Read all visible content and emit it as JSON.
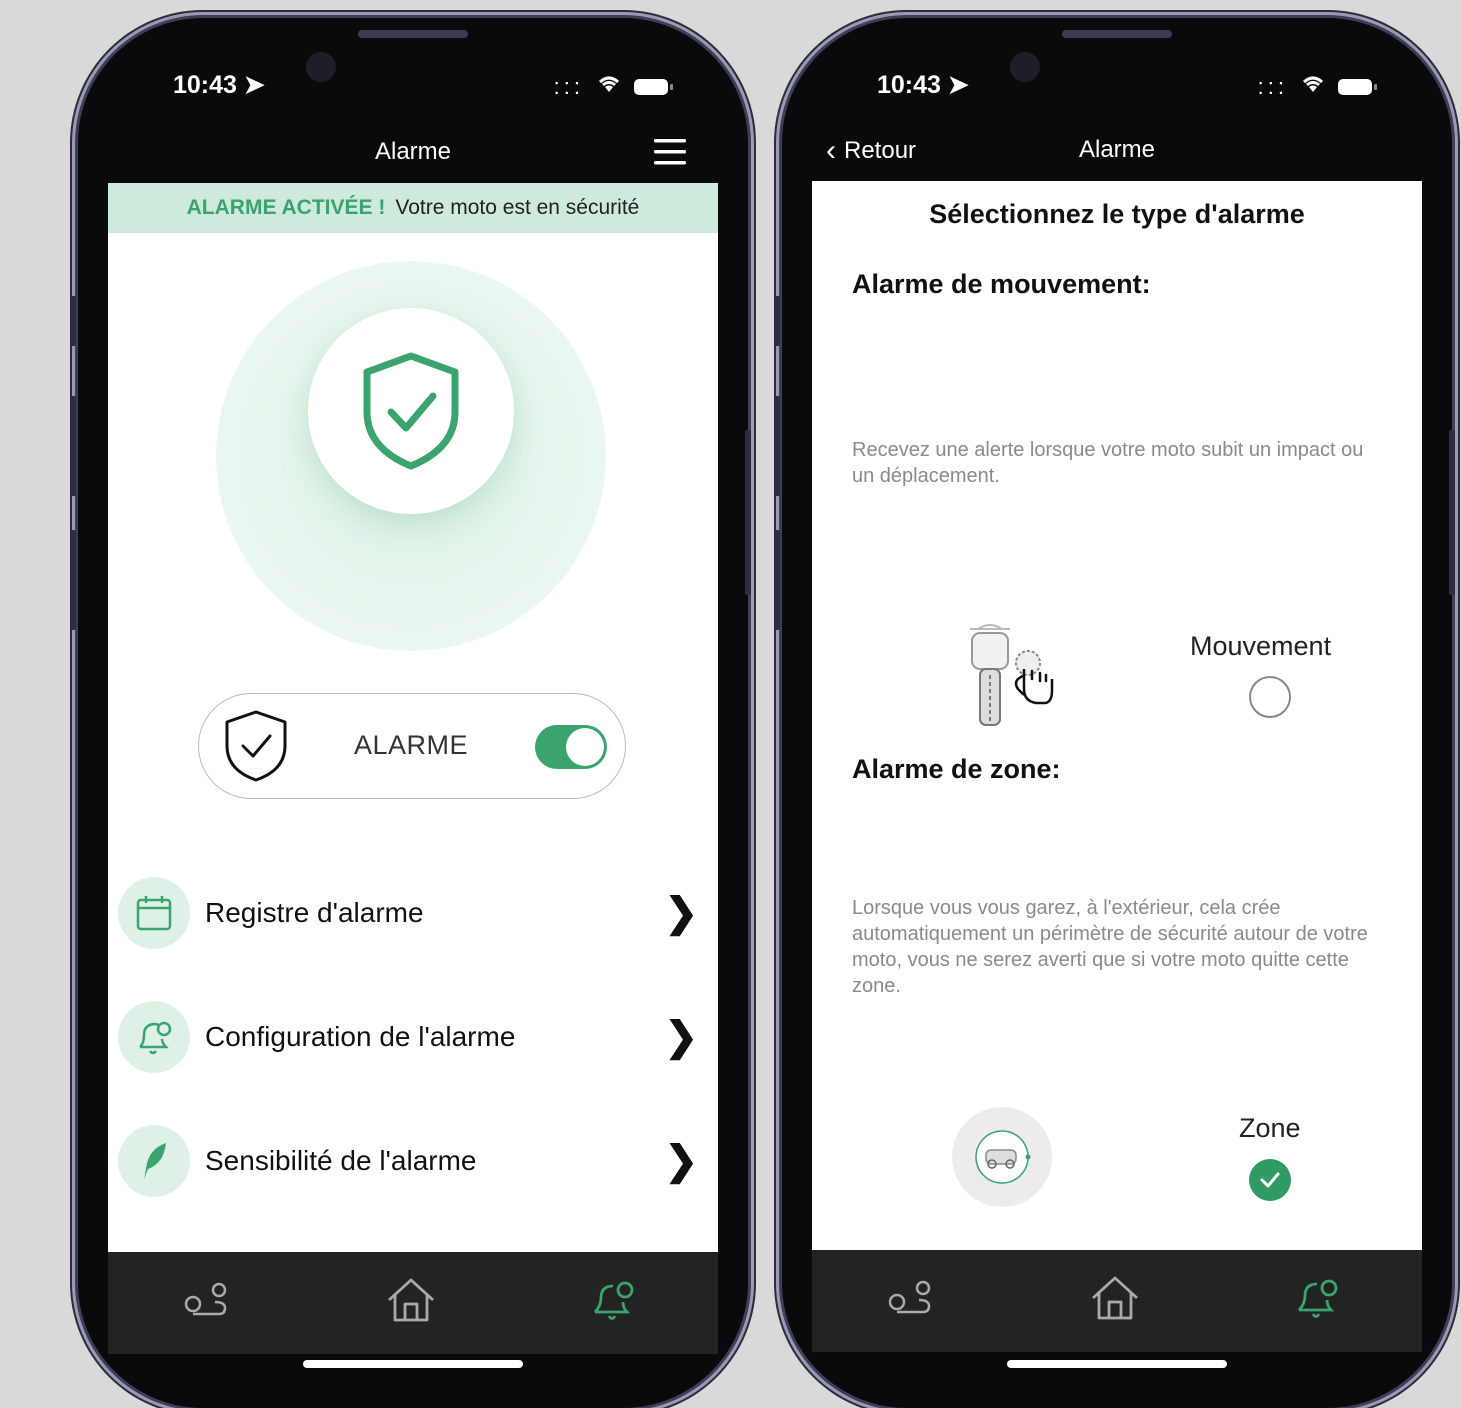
{
  "left_screen": {
    "status": {
      "time": "10:43"
    },
    "nav": {
      "title": "Alarme"
    },
    "banner": {
      "strong": "ALARME ACTIVÉE !",
      "message": "Votre moto est en sécurité"
    },
    "alarm_toggle": {
      "label": "ALARME",
      "on": true
    },
    "menu": [
      {
        "label": "Registre d'alarme",
        "icon": "calendar-icon"
      },
      {
        "label": "Configuration de l'alarme",
        "icon": "bell-gear-icon"
      },
      {
        "label": "Sensibilité de l'alarme",
        "icon": "feather-icon"
      }
    ],
    "tabs": [
      {
        "icon": "route-icon",
        "active": false
      },
      {
        "icon": "home-icon",
        "active": false
      },
      {
        "icon": "bell-gear-icon",
        "active": true
      }
    ]
  },
  "right_screen": {
    "status": {
      "time": "10:43"
    },
    "nav": {
      "back_label": "Retour",
      "title": "Alarme"
    },
    "heading": "Sélectionnez le type d'alarme",
    "movement": {
      "title": "Alarme de mouvement:",
      "description": "Recevez une alerte lorsque votre moto subit un impact ou un déplacement.",
      "option_label": "Mouvement",
      "selected": false
    },
    "zone": {
      "title": "Alarme de zone:",
      "description": "Lorsque vous vous garez, à l'extérieur, cela crée automatiquement un périmètre de sécurité autour de votre moto, vous ne serez averti que si votre moto quitte cette zone.",
      "option_label": "Zone",
      "selected": true
    }
  },
  "colors": {
    "accent": "#3aa36e",
    "banner_bg": "#cdeadb",
    "tabbar_bg": "#232323"
  }
}
